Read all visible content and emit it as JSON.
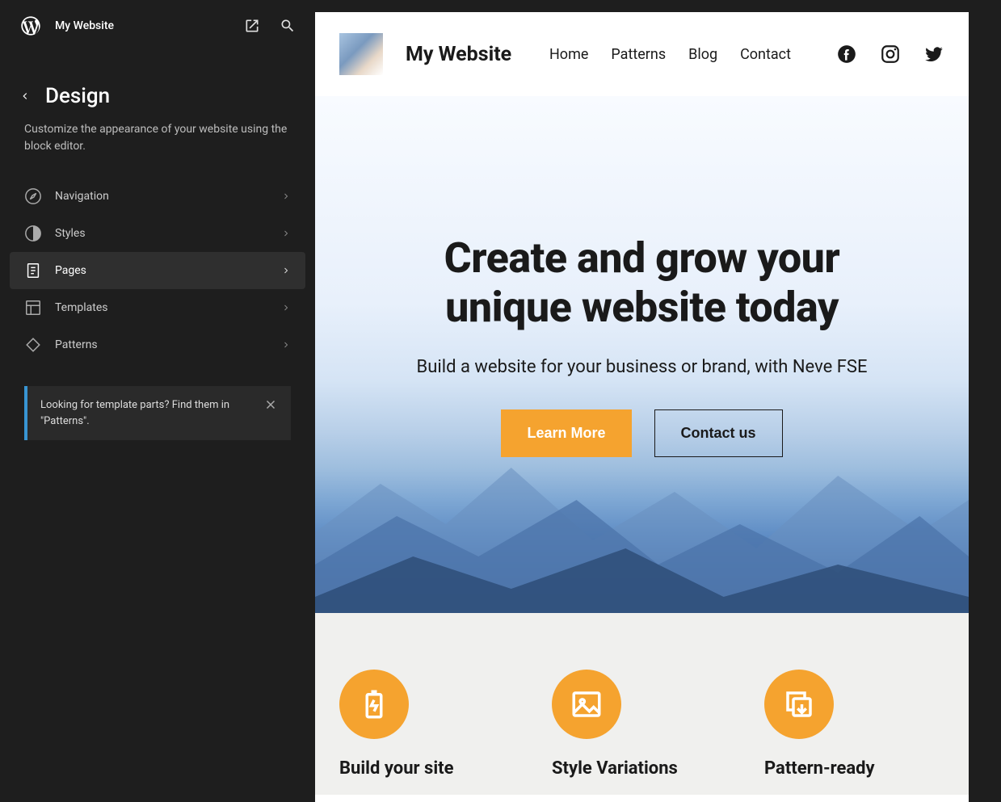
{
  "sidebar": {
    "site_name": "My Website",
    "section_title": "Design",
    "section_desc": "Customize the appearance of your website using the block editor.",
    "items": [
      {
        "label": "Navigation",
        "icon": "compass",
        "active": false
      },
      {
        "label": "Styles",
        "icon": "contrast",
        "active": false
      },
      {
        "label": "Pages",
        "icon": "page",
        "active": true
      },
      {
        "label": "Templates",
        "icon": "layout",
        "active": false
      },
      {
        "label": "Patterns",
        "icon": "diamond",
        "active": false
      }
    ],
    "notice": "Looking for template parts? Find them in \"Patterns\"."
  },
  "preview": {
    "site_title": "My Website",
    "nav": [
      "Home",
      "Patterns",
      "Blog",
      "Contact"
    ],
    "social": [
      "facebook",
      "instagram",
      "twitter"
    ],
    "hero": {
      "line1": "Create and grow your",
      "line2": "unique website today",
      "sub": "Build a website for your business or brand, with Neve FSE",
      "btn_primary": "Learn More",
      "btn_outline": "Contact us"
    },
    "features": [
      {
        "title": "Build your site",
        "icon": "battery"
      },
      {
        "title": "Style Variations",
        "icon": "image"
      },
      {
        "title": "Pattern-ready",
        "icon": "copy"
      }
    ],
    "colors": {
      "accent": "#f5a32f"
    }
  }
}
